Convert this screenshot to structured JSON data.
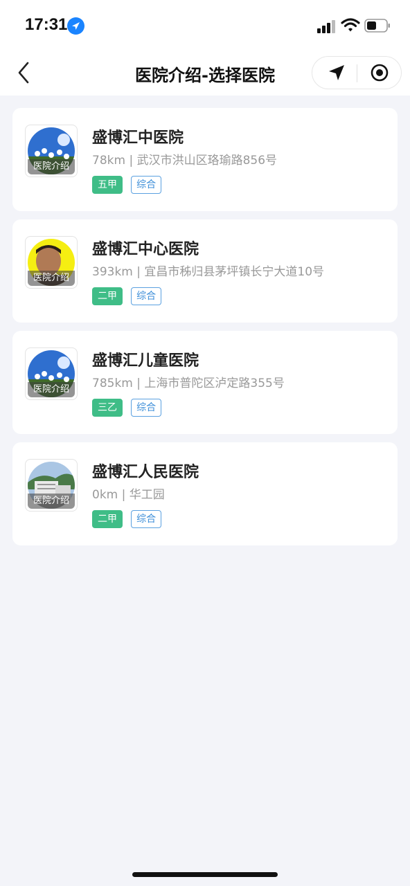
{
  "status_bar": {
    "time": "17:31"
  },
  "nav": {
    "title": "医院介绍-选择医院"
  },
  "hospitals": [
    {
      "name": "盛博汇中医院",
      "distance": "78km",
      "address": "武汉市洪山区珞瑜路856号",
      "level": "五甲",
      "type": "综合",
      "thumb_label": "医院介绍"
    },
    {
      "name": "盛博汇中心医院",
      "distance": "393km",
      "address": "宜昌市秭归县茅坪镇长宁大道10号",
      "level": "二甲",
      "type": "综合",
      "thumb_label": "医院介绍"
    },
    {
      "name": "盛博汇儿童医院",
      "distance": "785km",
      "address": "上海市普陀区泸定路355号",
      "level": "三乙",
      "type": "综合",
      "thumb_label": "医院介绍"
    },
    {
      "name": "盛博汇人民医院",
      "distance": "0km",
      "address": "华工园",
      "level": "二甲",
      "type": "综合",
      "thumb_label": "医院介绍"
    }
  ],
  "addr_separator": "|",
  "colors": {
    "level_tag": "#3fbd87",
    "type_tag": "#3c8ed8",
    "background": "#f3f4f9"
  }
}
